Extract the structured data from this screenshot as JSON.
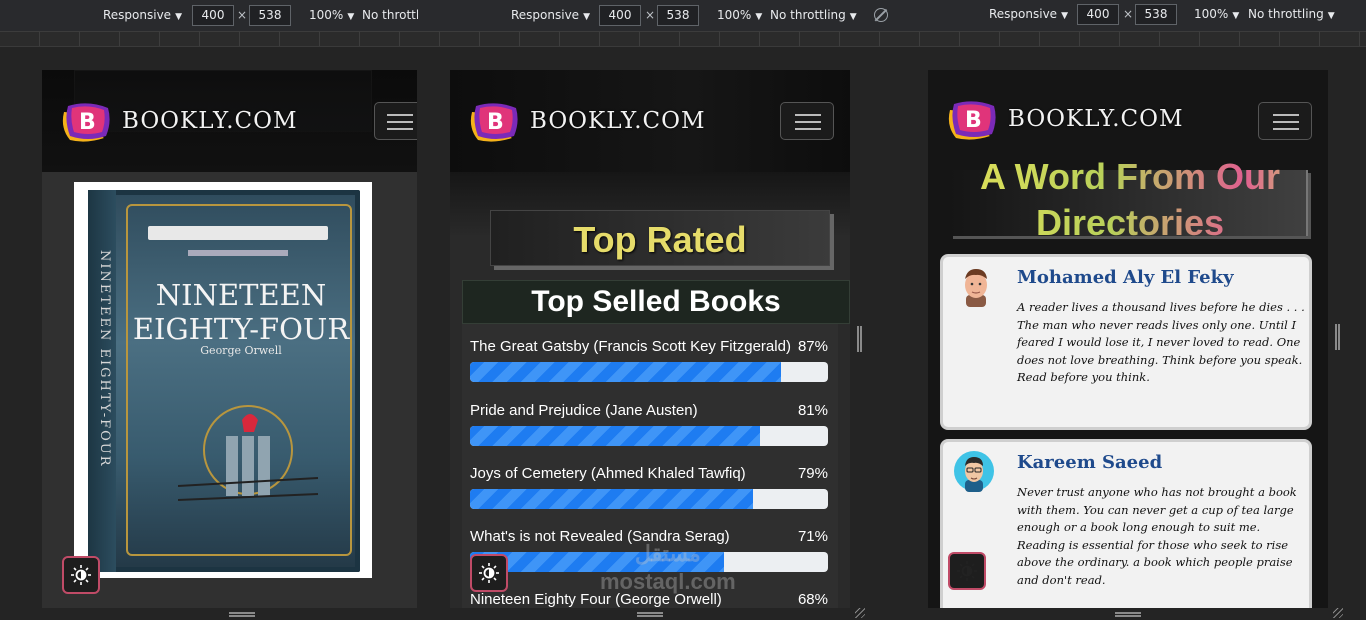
{
  "devtools": [
    {
      "mode": "Responsive",
      "width": "400",
      "height": "538",
      "zoom": "100%",
      "throttle": "No throttlin"
    },
    {
      "mode": "Responsive",
      "width": "400",
      "height": "538",
      "zoom": "100%",
      "throttle": "No throttling"
    },
    {
      "mode": "Responsive",
      "width": "400",
      "height": "538",
      "zoom": "100%",
      "throttle": "No throttling"
    }
  ],
  "times_sign": "×",
  "brand": "BOOKLY.COM",
  "book_cover": {
    "title_line1": "NINETEEN",
    "title_line2": "EIGHTY-FOUR",
    "author": "George Orwell",
    "spine": "NINETEEN EIGHTY-FOUR"
  },
  "top_rated": "Top Rated",
  "top_selled_title": "Top Selled Books",
  "books": [
    {
      "label": "The Great Gatsby (Francis Scott Key Fitzgerald)",
      "percent_text": "87%",
      "percent": 87
    },
    {
      "label": "Pride and Prejudice (Jane Austen)",
      "percent_text": "81%",
      "percent": 81
    },
    {
      "label": "Joys of Cemetery (Ahmed Khaled Tawfiq)",
      "percent_text": "79%",
      "percent": 79
    },
    {
      "label": "What's is not Revealed (Sandra Serag)",
      "percent_text": "71%",
      "percent": 71
    },
    {
      "label": "Nineteen Eighty Four (George Orwell)",
      "percent_text": "68%",
      "percent": 68
    }
  ],
  "watermark": {
    "line1": "مستقل",
    "line2": "mostaql.com"
  },
  "word_title": "A Word From Our Directories",
  "quotes": [
    {
      "name": "Mohamed Aly El Feky",
      "text": "A reader lives a thousand lives before he dies . . . The man who never reads lives only one. Until I feared I would lose it, I never loved to read. One does not love breathing. Think before you speak. Read before you think."
    },
    {
      "name": "Kareem Saeed",
      "text": "Never trust anyone who has not brought a book with them. You can never get a cup of tea large enough or a book long enough to suit me. Reading is essential for those who seek to rise above the ordinary. a book which people praise and don't read."
    }
  ],
  "colors": {
    "accent_gold": "#e6dc6a",
    "progress_blue": "#1e7cf1",
    "name_blue": "#1f4a8c",
    "theme_border": "#c04b67"
  },
  "icons": [
    "bookly-logo-icon",
    "hamburger-menu-icon",
    "sun-theme-icon",
    "rotate-icon",
    "avatar-icon"
  ]
}
